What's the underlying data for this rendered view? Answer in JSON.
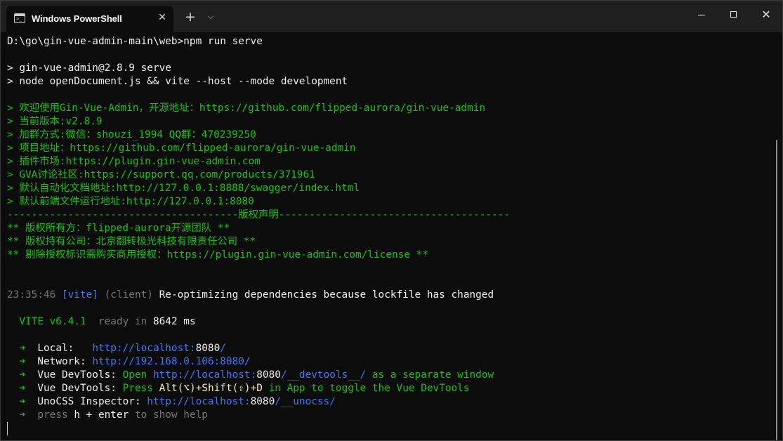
{
  "window": {
    "tab_title": "Windows PowerShell",
    "tab_icon": "terminal-icon",
    "tab_close": "✕",
    "new_tab": "+",
    "tab_dropdown": "⌵",
    "close_symbol": "✕"
  },
  "terminal": {
    "prompt": "D:\\go\\gin-vue-admin-main\\web>npm run serve",
    "script1": "> gin-vue-admin@2.8.9 serve",
    "script2": "> node openDocument.js && vite --host --mode development",
    "welcome": [
      "> 欢迎使用Gin-Vue-Admin，开源地址：https://github.com/flipped-aurora/gin-vue-admin",
      "> 当前版本:v2.8.9",
      "> 加群方式:微信：shouzi_1994 QQ群：470239250",
      "> 项目地址：https://github.com/flipped-aurora/gin-vue-admin",
      "> 插件市场:https://plugin.gin-vue-admin.com",
      "> GVA讨论社区:https://support.qq.com/products/371961",
      "> 默认自动化文档地址:http://127.0.0.1:8888/swagger/index.html",
      "> 默认前端文件运行地址:http://127.0.0.1:8080",
      "--------------------------------------版权声明--------------------------------------",
      "** 版权所有方：flipped-aurora开源团队 **",
      "** 版权持有公司：北京翻转极光科技有限责任公司 **",
      "** 剔除授权标识需购买商用授权：https://plugin.gin-vue-admin.com/license **"
    ],
    "log": {
      "time": "23:35:46",
      "tag": "[vite]",
      "scope": "(client)",
      "message": "Re-optimizing dependencies because lockfile has changed"
    },
    "vite": {
      "name": "VITE v6.4.1",
      "ready": "ready in",
      "ms": "8642",
      "unit": "ms"
    },
    "arrow": "➜",
    "local": {
      "label": "Local:",
      "prefix": "http://localhost:",
      "port": "8080",
      "suffix": "/"
    },
    "network": {
      "label": "Network:",
      "url": "http://192.168.0.106:8080/"
    },
    "devtools1": {
      "label": "Vue DevTools:",
      "open": "Open",
      "prefix": "http://localhost:",
      "port": "8080",
      "suffix": "/__devtools__/",
      "after": "as a separate window"
    },
    "devtools2": {
      "label": "Vue DevTools:",
      "press": "Press",
      "keys": "Alt(⌥)+Shift(⇧)+D",
      "after": "in App to toggle the Vue DevTools"
    },
    "unocss": {
      "label": "UnoCSS Inspector:",
      "prefix": "http://localhost:",
      "port": "8080",
      "suffix": "/__unocss/"
    },
    "help": {
      "press": "press",
      "key": "h + enter",
      "after": "to show help"
    }
  },
  "colors": {
    "background": "#0c0c0c",
    "titlebar": "#1f1f1f",
    "green": "#16c60c",
    "blue": "#3b78ff",
    "dim": "#767676",
    "text": "#cccccc"
  }
}
